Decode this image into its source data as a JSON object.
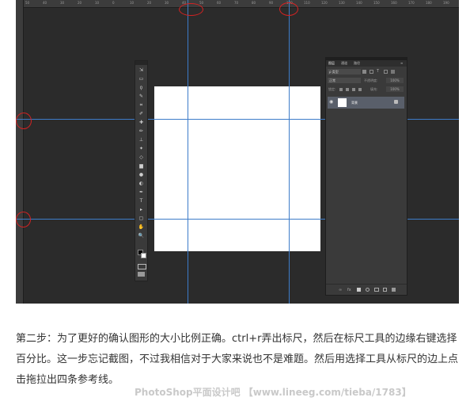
{
  "ruler": {
    "top_ticks": [
      "50",
      "40",
      "30",
      "20",
      "10",
      "0",
      "10",
      "20",
      "30",
      "40",
      "50",
      "60",
      "70",
      "80",
      "90",
      "100",
      "110",
      "120",
      "130",
      "140",
      "150",
      "160",
      "170",
      "180",
      "190"
    ]
  },
  "toolbar": {
    "tools": [
      "move-icon",
      "marquee-icon",
      "lasso-icon",
      "quick-select-icon",
      "crop-icon",
      "eyedropper-icon",
      "healing-icon",
      "brush-icon",
      "stamp-icon",
      "history-brush-icon",
      "eraser-icon",
      "gradient-icon",
      "blur-icon",
      "dodge-icon",
      "pen-icon",
      "type-icon",
      "path-select-icon",
      "shape-icon",
      "hand-icon",
      "zoom-icon"
    ]
  },
  "layers_panel": {
    "tabs": [
      "图层",
      "通道",
      "路径"
    ],
    "kind_label": "ρ 类型",
    "blend_mode": "正常",
    "opacity_label": "不透明度:",
    "opacity_value": "100%",
    "lock_label": "锁定:",
    "fill_label": "填充:",
    "fill_value": "100%",
    "layer_name": "背景"
  },
  "caption": {
    "text": "第二步：为了更好的确认图形的大小比例正确。ctrl+r弄出标尺，然后在标尺工具的边缘右键选择百分比。这一步忘记截图，不过我相信对于大家来说也不是难题。然后用选择工具从标尺的边上点击拖拉出四条参考线。"
  },
  "watermark": {
    "text": "PhotoShop平面设计吧 【www.lineeg.com/tieba/1783】"
  },
  "colors": {
    "workspace": "#2b2b2b",
    "guide": "#3d7cc9",
    "annotation": "#d42222"
  }
}
